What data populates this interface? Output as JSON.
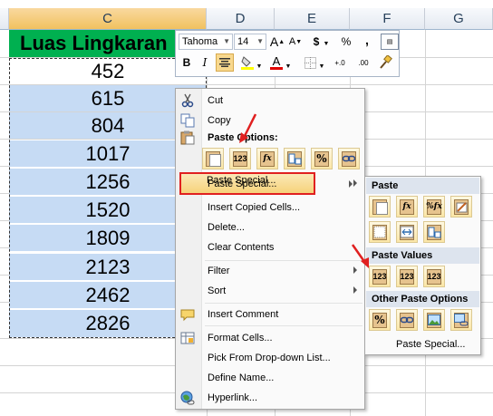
{
  "columns": [
    "C",
    "D",
    "E",
    "F",
    "G"
  ],
  "title_cell": "Luas Lingkaran",
  "values": [
    "452",
    "615",
    "804",
    "1017",
    "1256",
    "1520",
    "1809",
    "2123",
    "2462",
    "2826"
  ],
  "mini_toolbar": {
    "font_name": "Tahoma",
    "font_size": "14",
    "grow_font": "A",
    "shrink_font": "A",
    "currency": "$",
    "percent": "%",
    "comma": ",",
    "bold": "B",
    "italic": "I",
    "font_color": "A",
    "inc_decimal": "+.0",
    "dec_decimal": ".00"
  },
  "context_menu": {
    "cut": "Cut",
    "copy": "Copy",
    "paste_options_header": "Paste Options:",
    "paste_special": "Paste Special...",
    "insert_copied_cells": "Insert Copied Cells...",
    "delete": "Delete...",
    "clear_contents": "Clear Contents",
    "filter": "Filter",
    "sort": "Sort",
    "insert_comment": "Insert Comment",
    "format_cells": "Format Cells...",
    "pick_dropdown": "Pick From Drop-down List...",
    "define_name": "Define Name...",
    "hyperlink": "Hyperlink..."
  },
  "submenu": {
    "paste_header": "Paste",
    "paste_values_header": "Paste Values",
    "other_header": "Other Paste Options",
    "paste_special": "Paste Special..."
  },
  "button_labels": {
    "values": "123",
    "formulas": "fx",
    "formulas_numfmt": "%fx",
    "pct": "%"
  },
  "colors": {
    "title_fill": "#00b050",
    "selection_fill": "#c6dbf4",
    "highlight_border": "#e02020",
    "arrow": "#e02020"
  }
}
